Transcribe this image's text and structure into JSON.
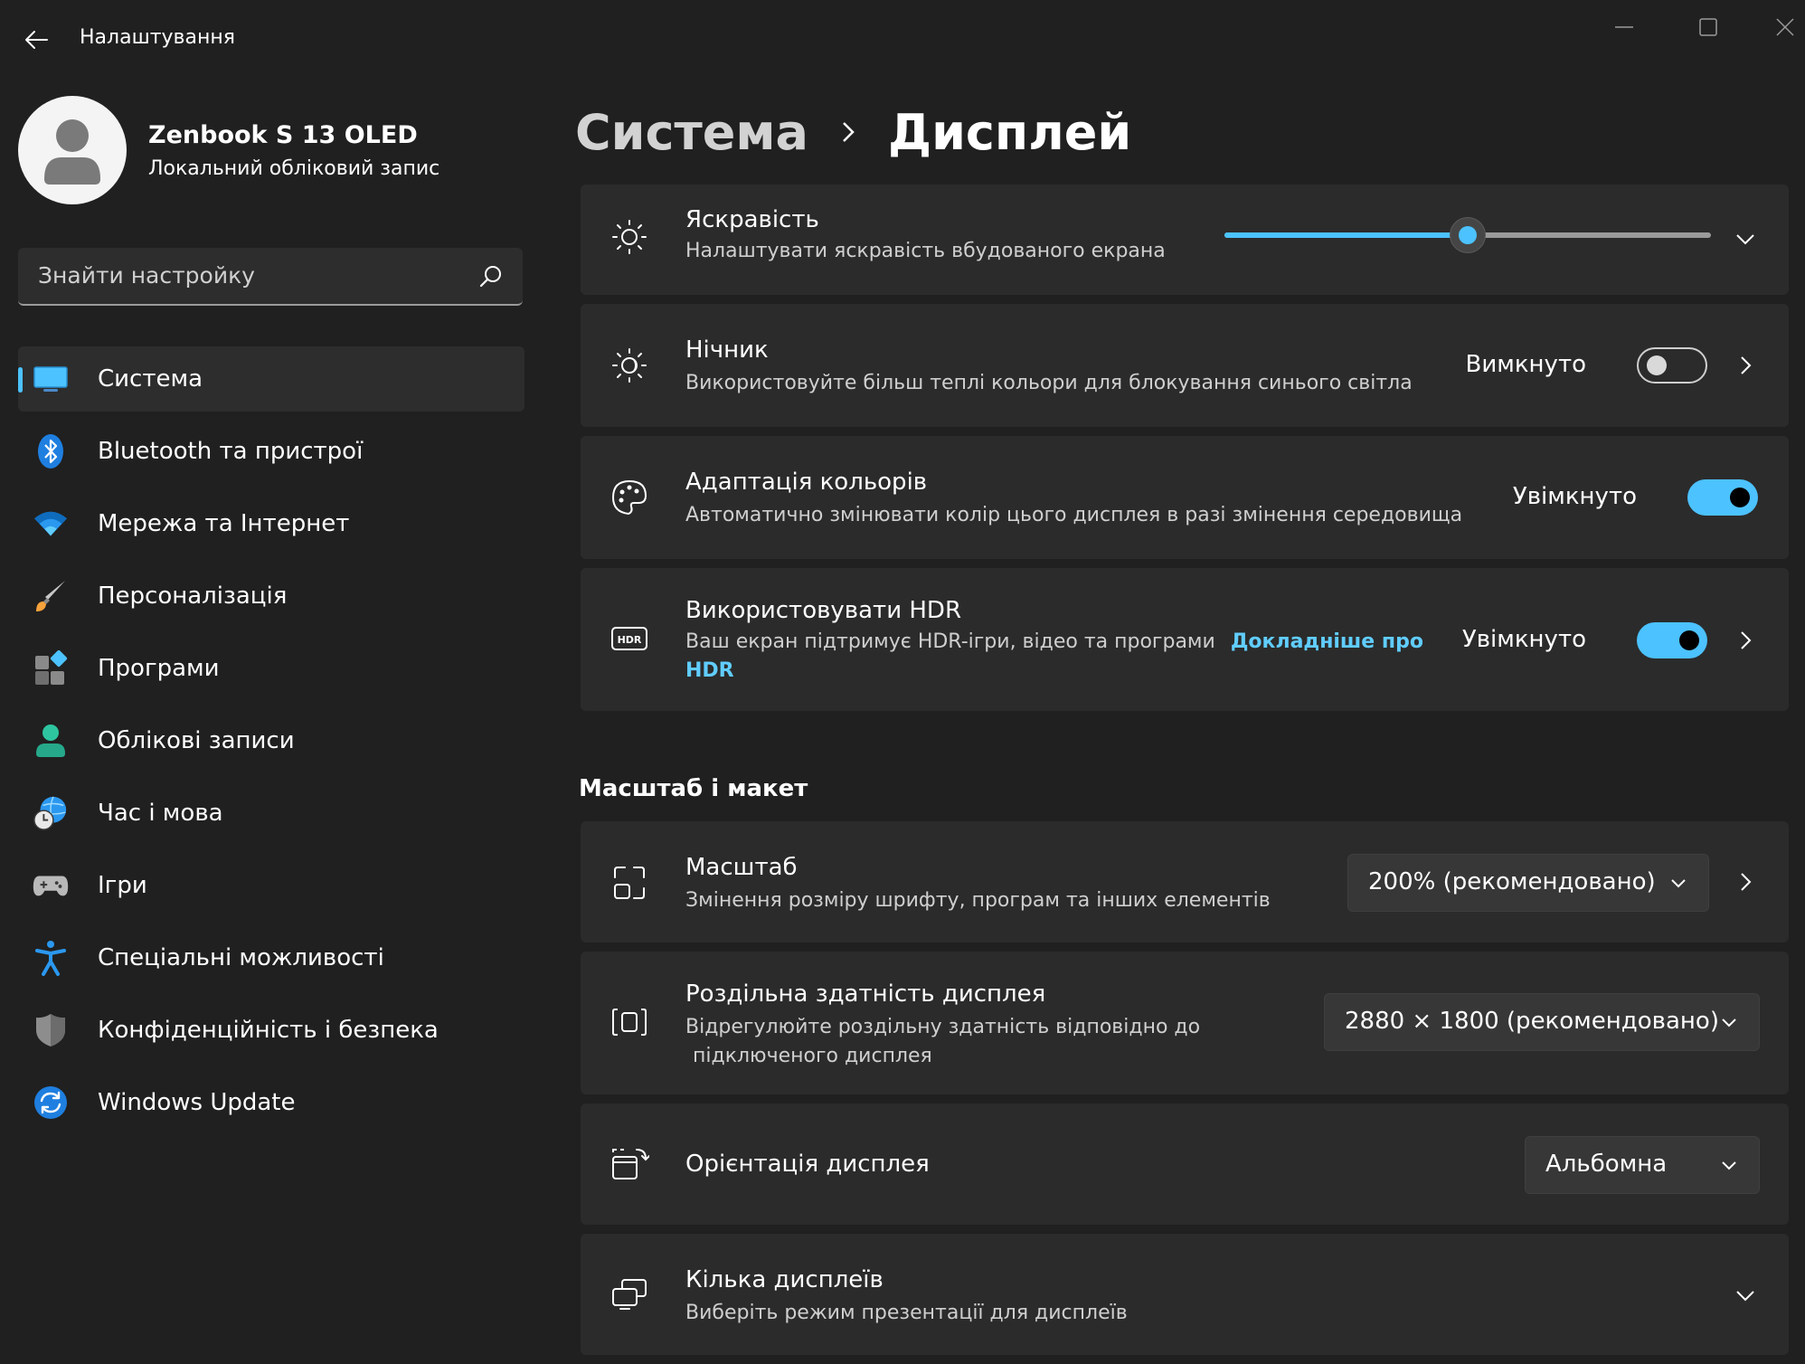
{
  "window": {
    "title": "Налаштування",
    "icons": {
      "back": "back-arrow-icon",
      "minimize": "minimize-icon",
      "maximize": "maximize-icon",
      "close": "close-icon"
    }
  },
  "profile": {
    "name": "Zenbook S 13 OLED",
    "account_type": "Локальний обліковий запис"
  },
  "search": {
    "placeholder": "Знайти настройку",
    "value": ""
  },
  "sidebar": {
    "active_index": 0,
    "items": [
      {
        "label": "Система",
        "icon": "system-display-icon"
      },
      {
        "label": "Bluetooth та пристрої",
        "icon": "bluetooth-icon"
      },
      {
        "label": "Мережа та Інтернет",
        "icon": "wifi-icon"
      },
      {
        "label": "Персоналізація",
        "icon": "brush-icon"
      },
      {
        "label": "Програми",
        "icon": "apps-icon"
      },
      {
        "label": "Облікові записи",
        "icon": "account-icon"
      },
      {
        "label": "Час і мова",
        "icon": "time-language-icon"
      },
      {
        "label": "Ігри",
        "icon": "gamepad-icon"
      },
      {
        "label": "Спеціальні можливості",
        "icon": "accessibility-icon"
      },
      {
        "label": "Конфіденційність і безпека",
        "icon": "shield-icon"
      },
      {
        "label": "Windows Update",
        "icon": "windows-update-icon"
      }
    ]
  },
  "breadcrumb": {
    "parent": "Система",
    "current": "Дисплей"
  },
  "colors": {
    "accent": "#4cc2ff",
    "link": "#60cdff",
    "background": "#202020",
    "card": "#2b2b2b"
  },
  "settings": {
    "brightness": {
      "title": "Яскравість",
      "description": "Налаштувати яскравість вбудованого екрана",
      "value_fraction": 0.5
    },
    "night_light": {
      "title": "Нічник",
      "description": "Використовуйте більш теплі кольори для блокування синього світла",
      "state": "Вимкнуто",
      "on": false
    },
    "color_adapt": {
      "title": "Адаптація кольорів",
      "description": "Автоматично змінювати колір цього дисплея в разі змінення середовища",
      "state": "Увімкнуто",
      "on": true
    },
    "hdr": {
      "title": "Використовувати HDR",
      "description": "Ваш екран підтримує HDR-ігри, відео та програми",
      "link_line1": "Докладніше про",
      "link_line2": "HDR",
      "state": "Увімкнуто",
      "on": true
    }
  },
  "scale_section": {
    "title": "Масштаб і макет",
    "scale": {
      "title": "Масштаб",
      "description": "Змінення розміру шрифту, програм та інших елементів",
      "value": "200% (рекомендовано)"
    },
    "resolution": {
      "title": "Роздільна здатність дисплея",
      "description_line1": "Відрегулюйте роздільну здатність відповідно до",
      "description_line2": "підключеного дисплея",
      "value": "2880 × 1800 (рекомендовано)"
    },
    "orientation": {
      "title": "Орієнтація дисплея",
      "value": "Альбомна"
    },
    "multiple_displays": {
      "title": "Кілька дисплеїв",
      "description": "Виберіть режим презентації для дисплеїв"
    }
  }
}
